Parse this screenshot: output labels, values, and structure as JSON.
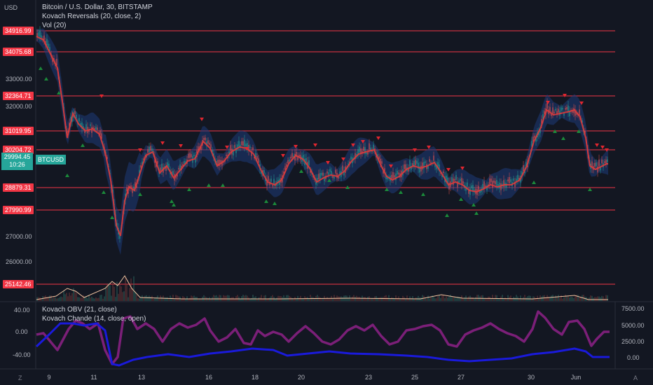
{
  "header": {
    "currency": "USD",
    "title": "Bitcoin / U.S. Dollar, 30, BITSTAMP",
    "indicator1": "Kovach Reversals (20, close, 2)",
    "indicator2": "Vol (20)"
  },
  "price_axis": {
    "labels": [
      "33000.00",
      "32000.00",
      "27000.00",
      "26000.00"
    ]
  },
  "levels": [
    "34916.99",
    "34075.68",
    "32364.71",
    "31019.95",
    "30204.72",
    "28879.31",
    "27990.99",
    "25142.46"
  ],
  "current": {
    "price": "29994.45",
    "countdown": "10:26",
    "ticker": "BTCUSD"
  },
  "lower_pane": {
    "legend1": "Kovach OBV (21, close)",
    "legend2": "Kovach Chande (14, close, open)",
    "left_axis": [
      "40.00",
      "0.00",
      "-40.00"
    ],
    "right_axis": [
      "7500.00",
      "5000.00",
      "2500.00",
      "0.00"
    ]
  },
  "x_axis": {
    "labels": [
      "9",
      "11",
      "13",
      "16",
      "18",
      "20",
      "23",
      "25",
      "27",
      "30",
      "Jun"
    ]
  },
  "corners": {
    "left": "Z",
    "right": "A"
  },
  "colors": {
    "background": "#131722",
    "level_line": "#f23645",
    "price_ma": "#e03a3a",
    "band": "#1e3a78",
    "up_arrow": "#1b8a3a",
    "down_arrow": "#e0262f",
    "obv": "#1a1adb",
    "chande": "#7b1f78",
    "volume_line": "#f0c3a0",
    "current_price": "#26a69a"
  },
  "chart_data": {
    "type": "line",
    "title": "Bitcoin / U.S. Dollar, 30, BITSTAMP",
    "series": [
      {
        "name": "BTCUSD",
        "x": [
          "9",
          "11",
          "13",
          "16",
          "18",
          "20",
          "23",
          "25",
          "27",
          "30",
          "Jun"
        ],
        "values": [
          31500,
          31500,
          28000,
          30500,
          29200,
          29300,
          30200,
          29600,
          29000,
          31700,
          30000
        ]
      }
    ],
    "ylim": [
      25000,
      35300
    ]
  }
}
